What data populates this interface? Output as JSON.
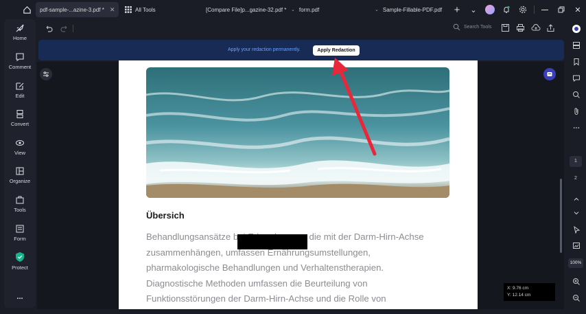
{
  "tabs": [
    {
      "label": "pdf-sample-...azine-3.pdf *",
      "active": true
    },
    {
      "label": "All Tools"
    },
    {
      "label": "[Compare  File]p...gazine-32.pdf *"
    },
    {
      "label": "form.pdf"
    },
    {
      "label": "Sample-Fillable-PDF.pdf"
    }
  ],
  "sidebar": {
    "items": [
      {
        "label": "Home",
        "icon": "rocket-icon"
      },
      {
        "label": "Comment",
        "icon": "comment-icon"
      },
      {
        "label": "Edit",
        "icon": "edit-icon"
      },
      {
        "label": "Convert",
        "icon": "convert-icon"
      },
      {
        "label": "View",
        "icon": "eye-icon"
      },
      {
        "label": "Organize",
        "icon": "organize-icon"
      },
      {
        "label": "Tools",
        "icon": "toolbox-icon"
      },
      {
        "label": "Form",
        "icon": "form-icon"
      },
      {
        "label": "Protect",
        "icon": "shield-icon"
      },
      {
        "label": "...",
        "icon": "more-icon"
      }
    ]
  },
  "toolbar": {
    "search_label": "Search Tools"
  },
  "banner": {
    "text": "Apply your redaction permanently.",
    "button_label": "Apply Redaction"
  },
  "document": {
    "heading": "Übersich",
    "lines": [
      "Behandlungsansätze bei Erkrankungen, die mit der Darm-Hirn-Achse",
      "zusammenhängen, umfassen Ernährungsumstellungen,",
      "pharmakologische Behandlungen und Verhaltenstherapien.",
      "Diagnostische Methoden umfassen die Beurteilung von",
      "Funktionsstörungen der Darm-Hirn-Achse und die Rolle von"
    ]
  },
  "pages": {
    "current": "1",
    "next": "2"
  },
  "zoom": "100%",
  "coordinates": {
    "x": "X: 9.76 cm",
    "y": "Y: 12.14 cm"
  },
  "colors": {
    "banner_bg": "#172b55",
    "banner_text": "#6fa0ff",
    "annotation_arrow": "#e8283a",
    "protect_accent": "#17b38a"
  }
}
